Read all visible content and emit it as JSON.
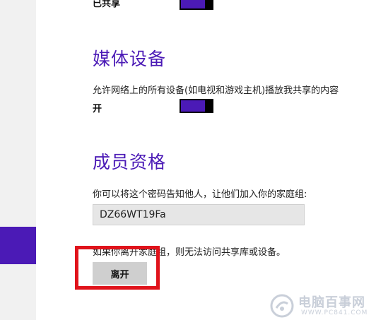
{
  "sharing_status": {
    "label": "已共享",
    "toggle_on": true
  },
  "media_devices": {
    "heading": "媒体设备",
    "description": "允许网络上的所有设备(如电视和游戏主机)播放我共享的内容",
    "toggle_label": "开",
    "toggle_on": true
  },
  "membership": {
    "heading": "成员资格",
    "description": "你可以将这个密码告知他人，让他们加入你的家庭组:",
    "password": "DZ66WT19Fa",
    "leave_note": "如果你离开家庭组，则无法访问共享库或设备。",
    "leave_button": "离开"
  },
  "colors": {
    "accent": "#4b1ab6",
    "highlight": "#e0131b"
  },
  "watermark": {
    "main": "电脑百事网",
    "sub": "WWW.PC841.COM"
  }
}
